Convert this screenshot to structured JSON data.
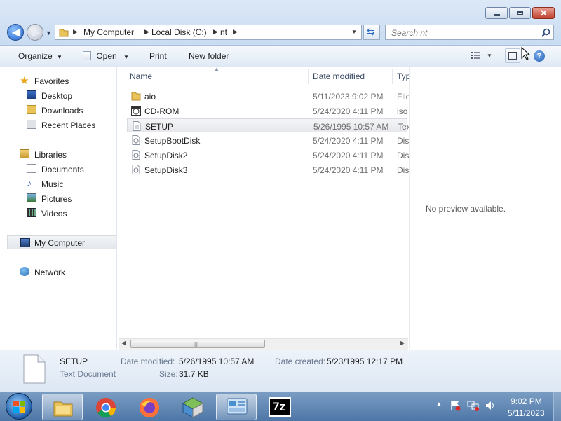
{
  "window": {
    "minimize_label": "Minimize",
    "maximize_label": "Maximize",
    "close_label": "Close"
  },
  "address": {
    "crumbs": [
      "My Computer",
      "Local Disk (C:)",
      "nt"
    ]
  },
  "search": {
    "placeholder": "Search nt"
  },
  "toolbar": {
    "organize": "Organize",
    "open": "Open",
    "print": "Print",
    "new_folder": "New folder"
  },
  "nav": {
    "favorites": "Favorites",
    "desktop": "Desktop",
    "downloads": "Downloads",
    "recent_places": "Recent Places",
    "libraries": "Libraries",
    "documents": "Documents",
    "music": "Music",
    "pictures": "Pictures",
    "videos": "Videos",
    "my_computer": "My Computer",
    "network": "Network"
  },
  "columns": {
    "name": "Name",
    "date_modified": "Date modified",
    "type": "Type"
  },
  "files": [
    {
      "name": "aio",
      "date": "5/11/2023 9:02 PM",
      "type": "File folder",
      "icon": "folder-icon"
    },
    {
      "name": "CD-ROM",
      "date": "5/24/2020 4:11 PM",
      "type": "iso",
      "icon": "iso-icon"
    },
    {
      "name": "SETUP",
      "date": "5/26/1995 10:57 AM",
      "type": "Text Document",
      "icon": "text-file-icon"
    },
    {
      "name": "SetupBootDisk",
      "date": "5/24/2020 4:11 PM",
      "type": "Disk",
      "icon": "disk-image-icon"
    },
    {
      "name": "SetupDisk2",
      "date": "5/24/2020 4:11 PM",
      "type": "Disk",
      "icon": "disk-image-icon"
    },
    {
      "name": "SetupDisk3",
      "date": "5/24/2020 4:11 PM",
      "type": "Disk",
      "icon": "disk-image-icon"
    }
  ],
  "preview": {
    "text": "No preview available."
  },
  "details": {
    "name": "SETUP",
    "type": "Text Document",
    "date_modified_label": "Date modified:",
    "date_modified": "5/26/1995 10:57 AM",
    "date_created_label": "Date created:",
    "date_created": "5/23/1995 12:17 PM",
    "size_label": "Size:",
    "size": "31.7 KB"
  },
  "tray": {
    "time": "9:02 PM",
    "date": "5/11/2023"
  },
  "taskbar": {
    "apps": [
      "start-orb-icon",
      "file-explorer-icon",
      "chrome-icon",
      "firefox-icon",
      "installer-icon",
      "control-panel-icon",
      "7zip-icon"
    ],
    "sevenzip_label": "7z"
  },
  "colors": {
    "accent": "#1d5fc7",
    "taskbar": "#5a80ae"
  }
}
